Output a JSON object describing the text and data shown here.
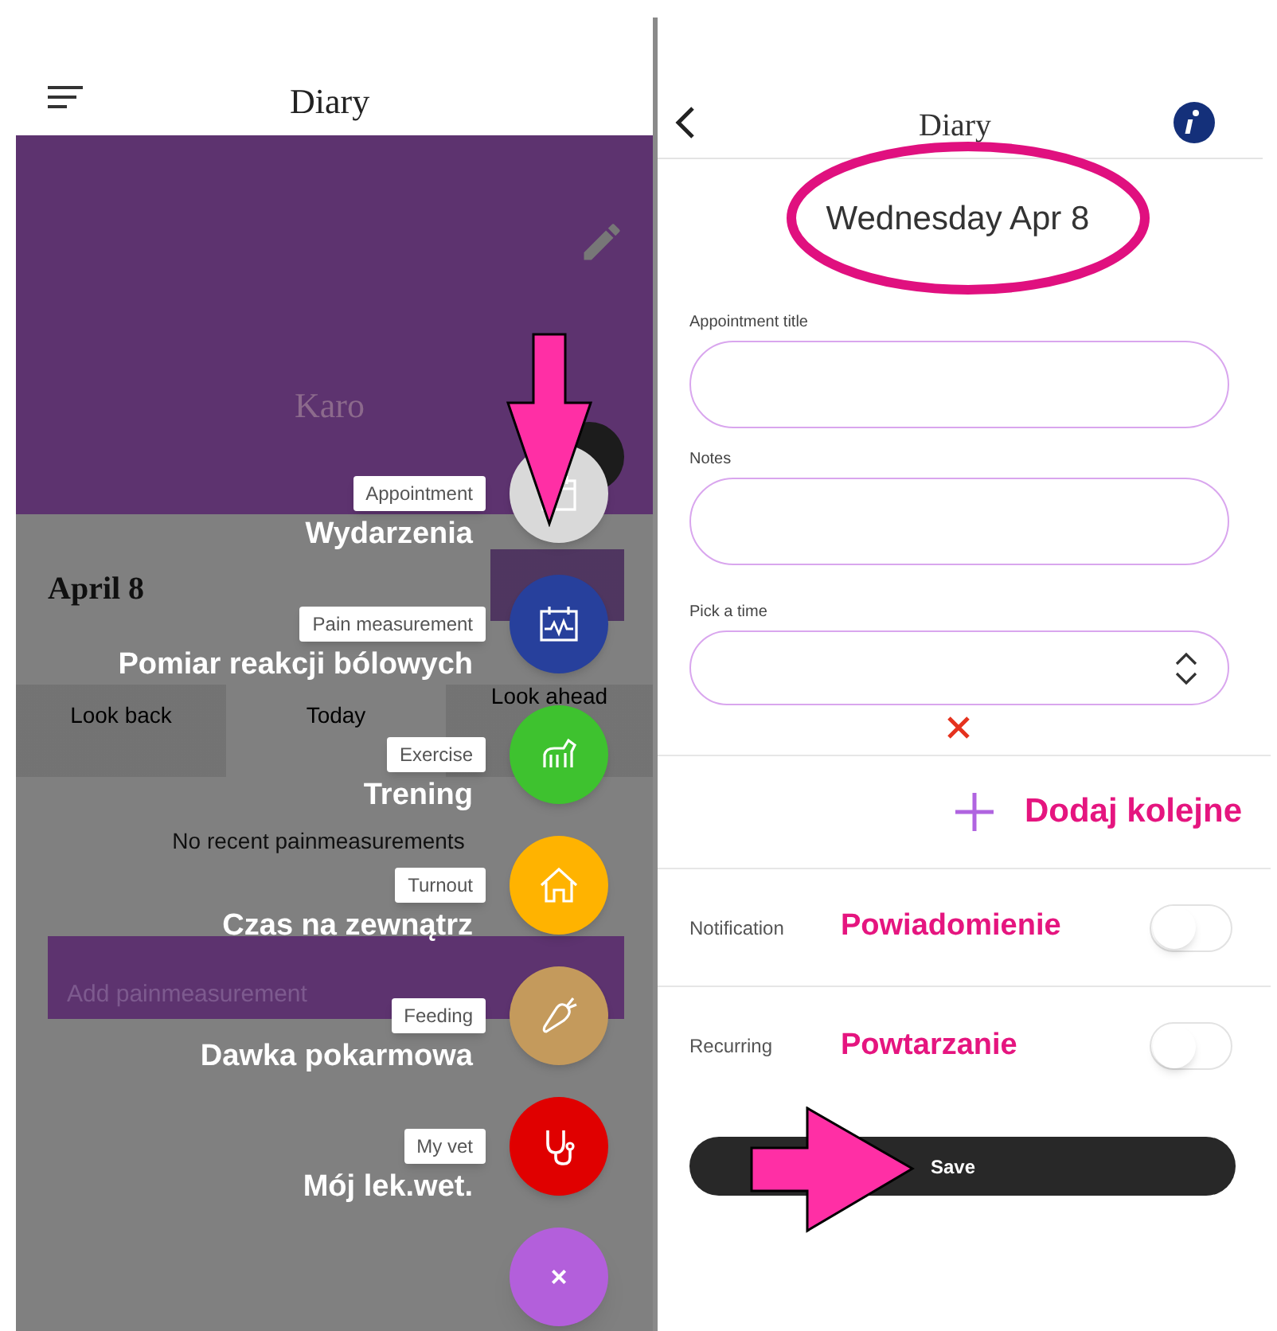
{
  "left_screen": {
    "title": "Diary",
    "profile_name": "Karo",
    "date": "April 8",
    "tabs": [
      {
        "label": "Look back",
        "selected": false
      },
      {
        "label": "Today",
        "selected": true
      },
      {
        "label": "Look ahead",
        "selected": false
      }
    ],
    "empty_message": "No recent painmeasurements",
    "add_button": "Add painmeasurement",
    "fab_menu": [
      {
        "kind": "appointment",
        "label": "Appointment",
        "annotation": "Wydarzenia",
        "color": "#d9d9d9"
      },
      {
        "kind": "pain",
        "label": "Pain measurement",
        "annotation": "Pomiar reakcji bólowych",
        "color": "#27409c"
      },
      {
        "kind": "exercise",
        "label": "Exercise",
        "annotation": "Trening",
        "color": "#3ec22f"
      },
      {
        "kind": "turnout",
        "label": "Turnout",
        "annotation": "Czas na zewnątrz",
        "color": "#ffb300"
      },
      {
        "kind": "feeding",
        "label": "Feeding",
        "annotation": "Dawka pokarmowa",
        "color": "#c49a5c"
      },
      {
        "kind": "vet",
        "label": "My vet",
        "annotation": "Mój lek.wet.",
        "color": "#e00000"
      }
    ],
    "close_button": "×"
  },
  "right_screen": {
    "title": "Diary",
    "date": "Wednesday Apr 8",
    "fields": [
      {
        "label": "Appointment title",
        "kind": "text"
      },
      {
        "label": "Notes",
        "kind": "text"
      },
      {
        "label": "Pick a time",
        "kind": "time"
      }
    ],
    "add_another": "Dodaj kolejne",
    "toggles": [
      {
        "label": "Notification",
        "annotation": "Powiadomienie",
        "on": false
      },
      {
        "label": "Recurring",
        "annotation": "Powtarzanie",
        "on": false
      }
    ],
    "save_button": "Save"
  }
}
